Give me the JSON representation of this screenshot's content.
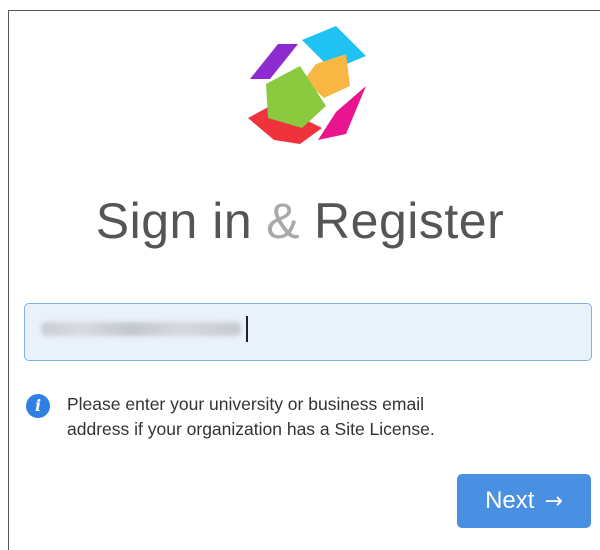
{
  "title": {
    "left": "Sign in",
    "amp": "&",
    "right": "Register"
  },
  "email": {
    "value": "",
    "redacted": true
  },
  "info": {
    "icon": "info-icon",
    "line1": "Please enter your university or business email",
    "line2": "address if your organization has a Site License."
  },
  "next_button": {
    "label": "Next",
    "arrow": "→",
    "color": "#4a90e2"
  },
  "logo": {
    "icon": "logo-icon",
    "colors": [
      "#8e2bd0",
      "#1ec0f2",
      "#f8b740",
      "#88c83c",
      "#f0323c",
      "#e8158f"
    ]
  }
}
